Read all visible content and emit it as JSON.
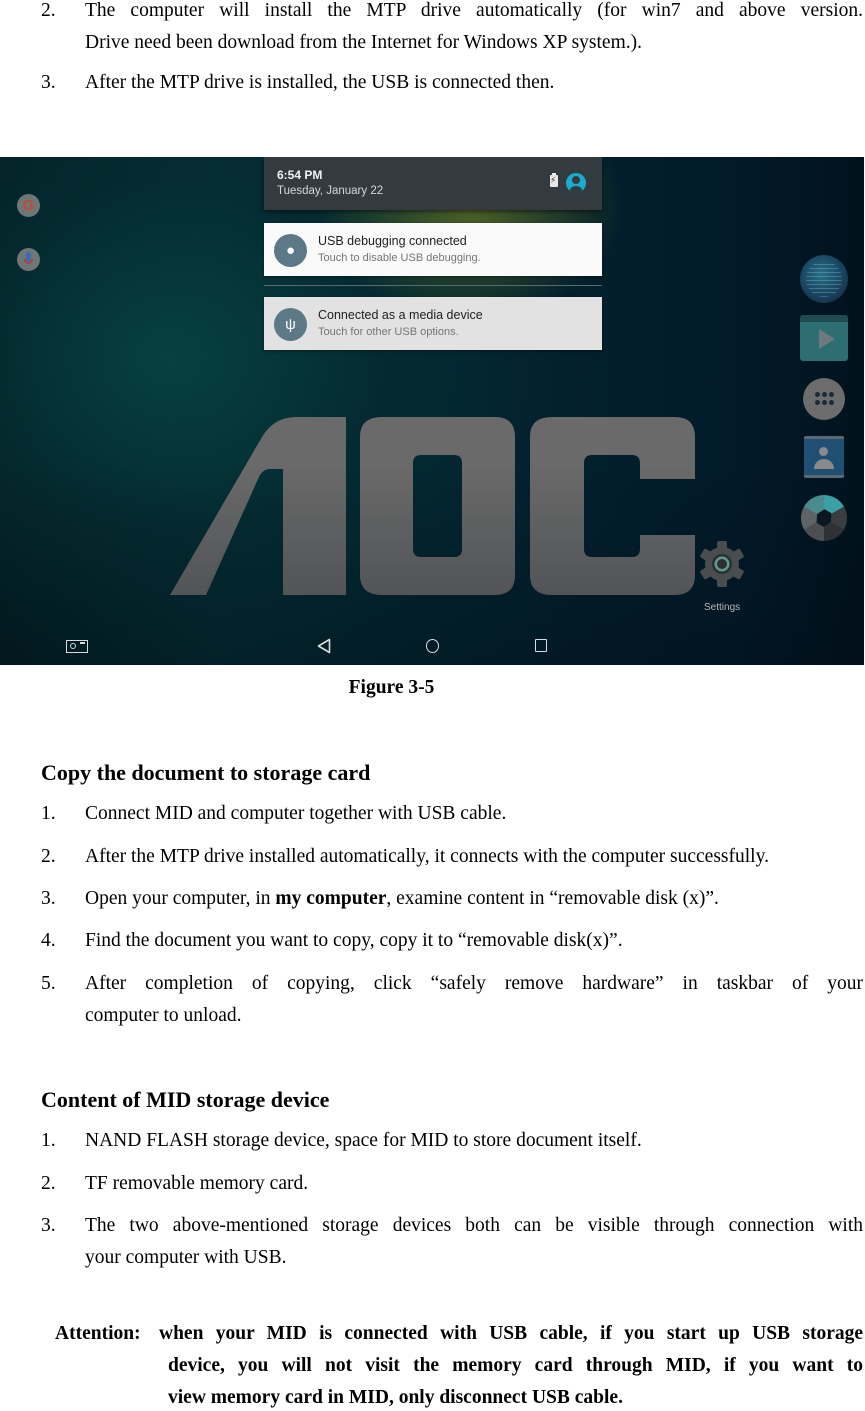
{
  "intro_steps": [
    {
      "number": "2.",
      "lines": [
        "The computer will install the MTP drive automatically (for win7 and above version.",
        "Drive need been download from the Internet for Windows XP system.)."
      ]
    },
    {
      "number": "3.",
      "lines": [
        "After the MTP drive is installed, the USB is connected then."
      ]
    }
  ],
  "screenshot": {
    "status": {
      "time": "6:54 PM",
      "date": "Tuesday, January 22",
      "battery_icon": "battery-charging-icon",
      "user_icon": "account-circle-icon",
      "user_color": "#1aaccc"
    },
    "notifications": [
      {
        "icon": "android-debug-icon",
        "title": "USB debugging connected",
        "subtitle": "Touch to disable USB debugging."
      },
      {
        "icon": "usb-icon",
        "title": "Connected as a media device",
        "subtitle": "Touch for other USB options."
      }
    ],
    "left_shortcuts": [
      {
        "name": "google-search",
        "glyph": "G"
      },
      {
        "name": "voice-search",
        "glyph": ""
      }
    ],
    "dock_apps": [
      "browser",
      "video-player",
      "all-apps",
      "contacts",
      "camera"
    ],
    "wallpaper_logo": "AOC",
    "desktop_shortcut": {
      "label": "Settings"
    },
    "navbar": [
      "screenshot",
      "back",
      "home",
      "recents"
    ]
  },
  "figure_caption": "Figure 3-5",
  "section_copy": {
    "heading": "Copy the document to storage card",
    "steps": [
      {
        "number": "1.",
        "text": "Connect MID and computer together with USB cable."
      },
      {
        "number": "2.",
        "text": "After the MTP drive installed automatically, it connects with the computer successfully."
      },
      {
        "number": "3.",
        "pre": "Open your computer, in ",
        "bold": "my computer",
        "post": ", examine content in “removable disk (x)”."
      },
      {
        "number": "4.",
        "text": "Find the document you want to copy, copy it to “removable disk(x)”."
      },
      {
        "number": "5.",
        "lines": [
          "After completion of copying, click “safely remove hardware” in taskbar of your",
          "computer to unload."
        ]
      }
    ]
  },
  "section_storage": {
    "heading": "Content of MID storage device",
    "steps": [
      {
        "number": "1.",
        "text": "NAND FLASH storage device, space for MID to store document itself."
      },
      {
        "number": "2.",
        "text": "TF removable memory card."
      },
      {
        "number": "3.",
        "lines": [
          "The two above-mentioned storage devices both can be visible through connection with",
          "your computer with USB."
        ]
      }
    ]
  },
  "attention": {
    "label": "Attention:",
    "lines": [
      "when your MID is connected with USB cable, if you start up USB storage",
      "device, you will not visit the memory card through MID, if you want to",
      "view memory card in MID, only disconnect USB cable."
    ]
  }
}
